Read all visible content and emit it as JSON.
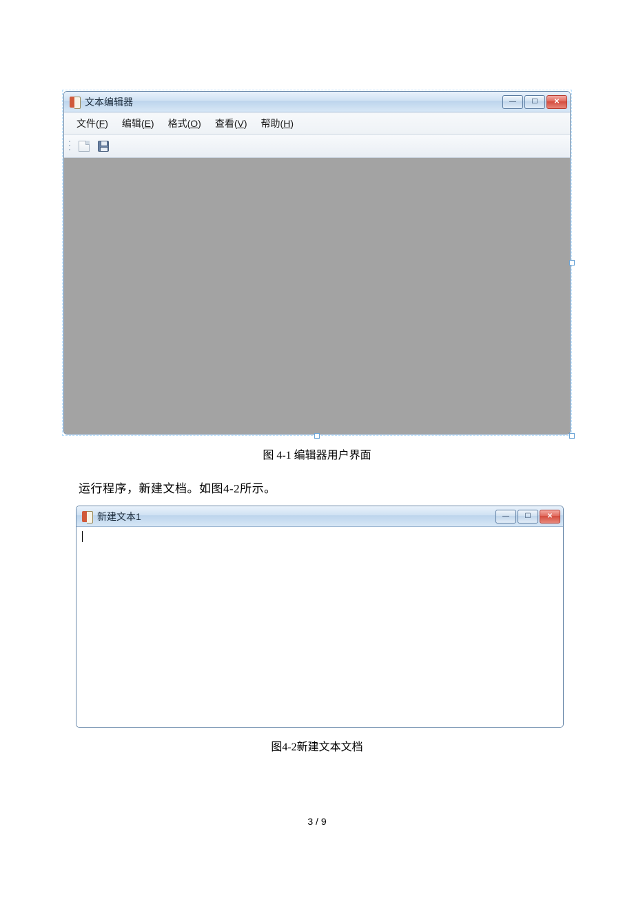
{
  "figure1": {
    "title": "文本编辑器",
    "menus": {
      "file": {
        "label": "文件",
        "accel": "F"
      },
      "edit": {
        "label": "编辑",
        "accel": "E"
      },
      "format": {
        "label": "格式",
        "accel": "O"
      },
      "view": {
        "label": "查看",
        "accel": "V"
      },
      "help": {
        "label": "帮助",
        "accel": "H"
      }
    },
    "caption": "图 4-1  编辑器用户界面"
  },
  "body_text": "运行程序，新建文档。如图4-2所示。",
  "figure2": {
    "title": "新建文本1",
    "caption": "图4-2新建文本文档"
  },
  "win_controls": {
    "minimize": "—",
    "maximize": "☐",
    "close": "✕"
  },
  "page_number": "3 / 9"
}
